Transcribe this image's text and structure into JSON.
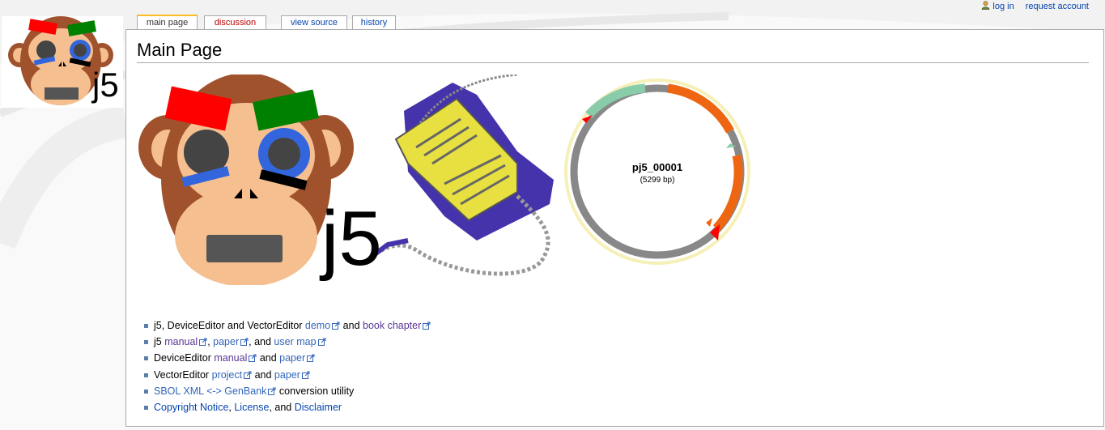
{
  "personal": {
    "login": "log in",
    "request_account": "request account"
  },
  "tabs": [
    {
      "label": "main page",
      "state": "selected"
    },
    {
      "label": "discussion",
      "state": "new"
    },
    {
      "label": "view source",
      "state": "normal"
    },
    {
      "label": "history",
      "state": "normal"
    }
  ],
  "logo": {
    "text": "j5"
  },
  "page": {
    "title": "Main Page",
    "banner_text": "j5"
  },
  "plasmid": {
    "name": "pj5_00001",
    "length": "(5299 bp)"
  },
  "links": {
    "item1": {
      "text_a": "j5, DeviceEditor and VectorEditor ",
      "link_a": "demo",
      "text_b": " and ",
      "link_b": "book chapter"
    },
    "item2": {
      "text_a": "j5 ",
      "link_a": "manual",
      "text_b": ", ",
      "link_b": "paper",
      "text_c": ", and ",
      "link_c": "user map"
    },
    "item3": {
      "text_a": "DeviceEditor ",
      "link_a": "manual",
      "text_b": " and ",
      "link_b": "paper"
    },
    "item4": {
      "text_a": "VectorEditor ",
      "link_a": "project",
      "text_b": " and ",
      "link_b": "paper"
    },
    "item5": {
      "link_a": "SBOL XML <-> GenBank",
      "text_b": " conversion utility"
    },
    "item6": {
      "link_a": "Copyright Notice",
      "text_b": ", ",
      "link_b": "License",
      "text_c": ", and ",
      "link_c": "Disclaimer"
    }
  },
  "colors": {
    "link": "#3366bb",
    "visited_link": "#5a3696",
    "tab_highlight": "#fabd23",
    "monkey_brown": "#a0522d",
    "monkey_face": "#f5bf90",
    "eyebrow_red": "#ff0000",
    "eyebrow_green": "#008000",
    "eye_blue": "#3366dd",
    "plasmid_orange": "#ee6611",
    "plasmid_green": "#88ccaa",
    "plasmid_gray": "#888888"
  }
}
